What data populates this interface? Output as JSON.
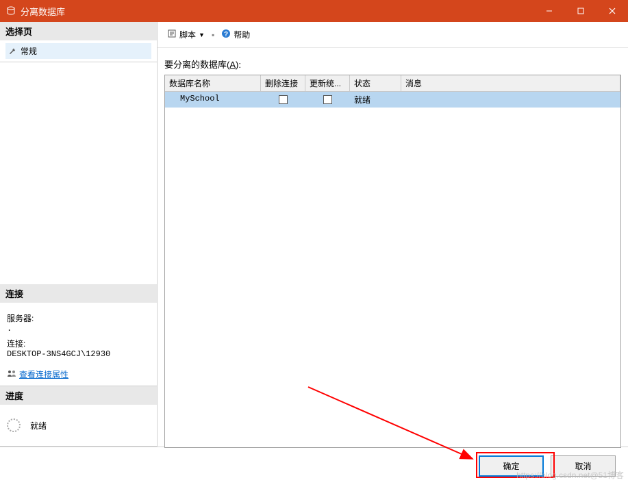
{
  "window": {
    "title": "分离数据库"
  },
  "sidebar": {
    "select_page": {
      "header": "选择页",
      "items": [
        {
          "label": "常规",
          "icon": "wrench"
        }
      ]
    },
    "connection": {
      "header": "连接",
      "server_label": "服务器:",
      "server_value": ".",
      "conn_label": "连接:",
      "conn_value": "DESKTOP-3NS4GCJ\\12930",
      "link": "查看连接属性"
    },
    "progress": {
      "header": "进度",
      "status": "就绪"
    }
  },
  "toolbar": {
    "script_label": "脚本",
    "help_label": "帮助"
  },
  "content": {
    "section_label_pre": "要分离的数据库(",
    "section_label_key": "A",
    "section_label_post": "):",
    "columns": {
      "name": "数据库名称",
      "drop_conn": "删除连接",
      "update_stats": "更新统...",
      "status": "状态",
      "message": "消息"
    },
    "rows": [
      {
        "name": "MySchool",
        "drop_conn": false,
        "update_stats": false,
        "status": "就绪",
        "message": ""
      }
    ]
  },
  "buttons": {
    "ok": "确定",
    "cancel": "取消"
  },
  "watermark": "https://blog.csdn.net@51博客"
}
